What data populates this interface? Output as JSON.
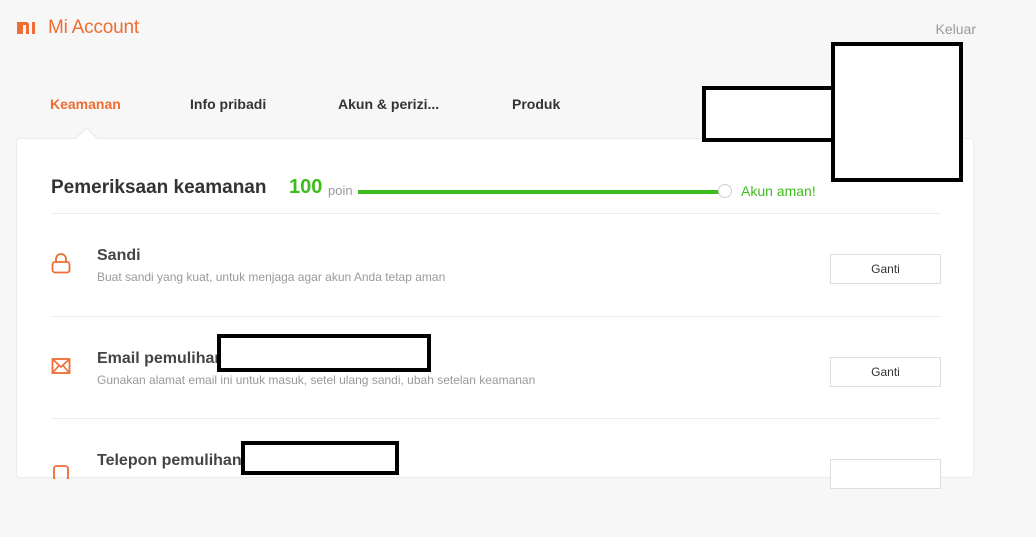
{
  "header": {
    "brand_icon": "mi-logo",
    "app_title": "Mi Account",
    "logout_label": "Keluar",
    "accent_color": "#ef6c32"
  },
  "tabs": [
    {
      "label": "Keamanan",
      "active": true
    },
    {
      "label": "Info pribadi",
      "active": false
    },
    {
      "label": "Akun & perizi...",
      "active": false
    },
    {
      "label": "Produk",
      "active": false
    }
  ],
  "security_check": {
    "title": "Pemeriksaan keamanan",
    "score": "100",
    "score_unit": "poin",
    "progress_percent": 100,
    "status_label": "Akun aman!",
    "status_color": "#3dbd1a"
  },
  "items": [
    {
      "icon": "lock-icon",
      "title": "Sandi",
      "description": "Buat sandi yang kuat, untuk menjaga agar akun Anda tetap aman",
      "button_label": "Ganti"
    },
    {
      "icon": "envelope-icon",
      "title": "Email pemulihan",
      "description": "Gunakan alamat email ini untuk masuk, setel ulang sandi, ubah setelan keamanan",
      "button_label": "Ganti"
    },
    {
      "icon": "phone-icon",
      "title": "Telepon pemulihan",
      "description": "",
      "button_label": ""
    }
  ]
}
